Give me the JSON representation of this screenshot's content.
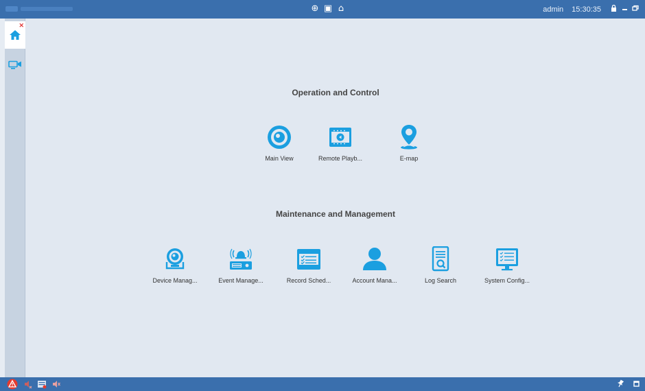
{
  "titlebar": {
    "user": "admin",
    "clock": "15:30:35",
    "center_icons": [
      "globe-icon",
      "monitor-icon",
      "network-icon"
    ],
    "window_buttons": [
      "lock-icon",
      "minimize-icon",
      "restore-icon"
    ]
  },
  "sidebar": {
    "tabs": [
      {
        "icon": "home-icon",
        "active": true
      },
      {
        "icon": "main-view-tab-icon",
        "active": false
      }
    ]
  },
  "operation": {
    "title": "Operation and Control",
    "items": [
      {
        "label": "Main View",
        "icon": "main-view-icon"
      },
      {
        "label": "Remote Playb...",
        "icon": "remote-playback-icon"
      },
      {
        "label": "E-map",
        "icon": "map-pin-icon"
      }
    ]
  },
  "maintenance": {
    "title": "Maintenance and Management",
    "items": [
      {
        "label": "Device Manag...",
        "icon": "camera-icon"
      },
      {
        "label": "Event Manage...",
        "icon": "alarm-icon"
      },
      {
        "label": "Record Sched...",
        "icon": "schedule-icon"
      },
      {
        "label": "Account Mana...",
        "icon": "user-icon"
      },
      {
        "label": "Log Search",
        "icon": "log-search-icon"
      },
      {
        "label": "System Config...",
        "icon": "system-config-icon"
      }
    ]
  },
  "statusbar": {
    "left_icons": [
      "alert-icon",
      "alarm-sound-icon",
      "event-icon",
      "speaker-mute-icon"
    ],
    "right_icons": [
      "pin-icon",
      "window-icon"
    ]
  },
  "colors": {
    "accent": "#1b9fe0",
    "titlebar": "#3a6fad",
    "background": "#e1e8f1"
  }
}
